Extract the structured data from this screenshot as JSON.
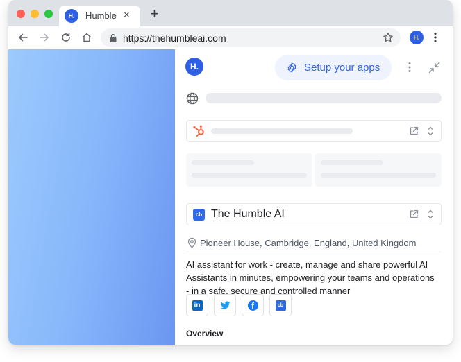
{
  "browser": {
    "tab_title": "Humble",
    "tab_favicon_text": "H.",
    "close_glyph": "×",
    "new_tab_glyph": "+",
    "url": "https://thehumbleai.com",
    "profile_text": "H."
  },
  "panel": {
    "logo_text": "H.",
    "setup_button_label": "Setup your apps",
    "company": {
      "logo_text": "cb",
      "name": "The Humble AI",
      "location": "Pioneer House, Cambridge, England, United Kingdom",
      "description": "AI assistant for work - create, manage and share powerful AI Assistants in minutes, empowering your teams and  operations - in a safe, secure and controlled manner"
    },
    "socials": [
      {
        "name": "linkedin",
        "text": "in",
        "color": "#0a66c2"
      },
      {
        "name": "twitter",
        "icon": "twitter-bird-icon",
        "color": "#1d9bf0"
      },
      {
        "name": "facebook",
        "text": "f",
        "color": "#1877f2"
      },
      {
        "name": "crunchbase",
        "text": "cb",
        "color": "#2f69e6"
      }
    ],
    "overview_heading": "Overview"
  },
  "colors": {
    "brand": "#2f5fe6",
    "accent_text": "#3366e5",
    "hubspot": "#ff5c35"
  }
}
